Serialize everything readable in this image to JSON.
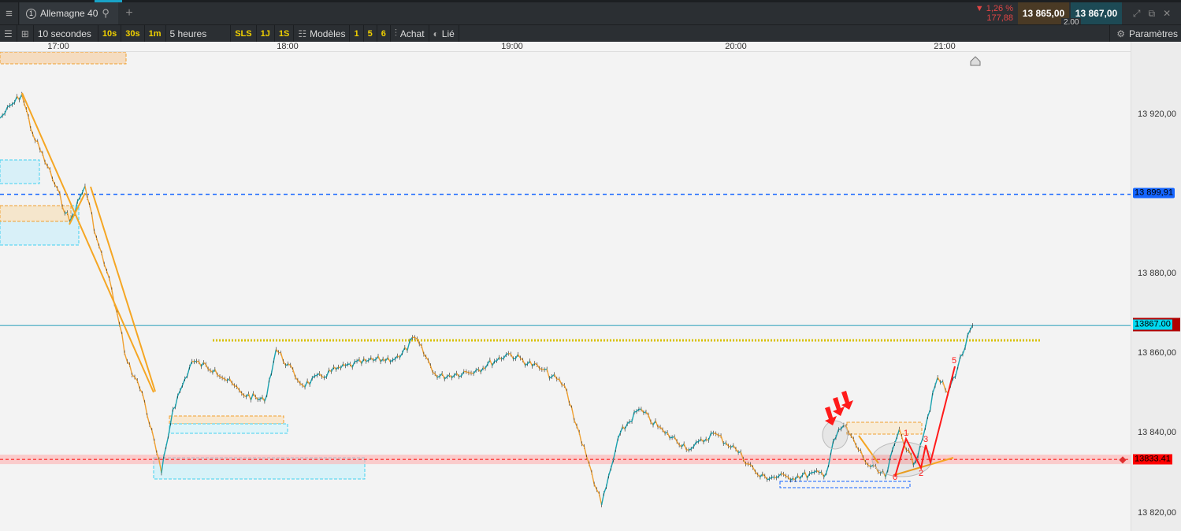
{
  "header": {
    "menu_icon": "hamburger-icon",
    "tab_number": "1",
    "tab_title": "Allemagne 40",
    "search_icon": "search-icon",
    "add_tab": "+",
    "change_pct": "▼ 1,26 %",
    "change_abs": "177,88",
    "bid": "13 865,00",
    "ask": "13 867,00",
    "spread": "2,00"
  },
  "toolbar": {
    "interval": "10 secondes",
    "quick_intervals": [
      "10s",
      "30s",
      "1m"
    ],
    "range": "5 heures",
    "quick_ranges": [
      "SLS",
      "1J",
      "1S"
    ],
    "templates": "Modèles",
    "template_slots": [
      "1",
      "5",
      "6"
    ],
    "buy": "Achat",
    "linked": "Lié",
    "settings": "Paramètres"
  },
  "chart_data": {
    "type": "line",
    "instrument": "Allemagne 40",
    "x_ticks": [
      "17:00",
      "18:00",
      "19:00",
      "20:00",
      "21:00"
    ],
    "y_ticks": [
      "13 920,00",
      "13 880,00",
      "13 860,00",
      "13 840,00",
      "13 820,00"
    ],
    "y_tick_values": [
      13920,
      13880,
      13860,
      13840,
      13820
    ],
    "ylim": [
      13816,
      13934
    ],
    "series": [
      {
        "points": [
          [
            "16:44",
            13919
          ],
          [
            "16:50",
            13925
          ],
          [
            "16:53",
            13915
          ],
          [
            "16:57",
            13907
          ],
          [
            "17:03",
            13893
          ],
          [
            "17:07",
            13902
          ],
          [
            "17:10",
            13889
          ],
          [
            "17:14",
            13876
          ],
          [
            "17:18",
            13858
          ],
          [
            "17:22",
            13850
          ],
          [
            "17:27",
            13830
          ],
          [
            "17:30",
            13846
          ],
          [
            "17:35",
            13858
          ],
          [
            "17:41",
            13856
          ],
          [
            "17:48",
            13850
          ],
          [
            "17:54",
            13848
          ],
          [
            "17:57",
            13861
          ],
          [
            "18:04",
            13852
          ],
          [
            "18:13",
            13856
          ],
          [
            "18:21",
            13858
          ],
          [
            "18:30",
            13859
          ],
          [
            "18:34",
            13864
          ],
          [
            "18:40",
            13854
          ],
          [
            "18:51",
            13856
          ],
          [
            "18:59",
            13860
          ],
          [
            "19:08",
            13856
          ],
          [
            "19:14",
            13852
          ],
          [
            "19:20",
            13834
          ],
          [
            "19:24",
            13822
          ],
          [
            "19:29",
            13840
          ],
          [
            "19:34",
            13846
          ],
          [
            "19:41",
            13840
          ],
          [
            "19:48",
            13836
          ],
          [
            "19:54",
            13840
          ],
          [
            "20:00",
            13836
          ],
          [
            "20:07",
            13829
          ],
          [
            "20:15",
            13829
          ],
          [
            "20:26",
            13830
          ],
          [
            "20:28",
            13838
          ],
          [
            "20:31",
            13842
          ],
          [
            "20:38",
            13832
          ],
          [
            "20:43",
            13829
          ],
          [
            "20:47",
            13841
          ],
          [
            "20:51",
            13832
          ],
          [
            "20:53",
            13837
          ],
          [
            "20:58",
            13854
          ],
          [
            "21:01",
            13850
          ],
          [
            "21:08",
            13867
          ]
        ]
      }
    ],
    "levels": [
      {
        "label": "13 899,91",
        "value": 13899.91,
        "color": "#1565ff"
      },
      {
        "label": "13867.00",
        "value": 13867.0,
        "color": "#00d8f0"
      },
      {
        "label": "13833.41",
        "value": 13833.41,
        "color": "#ff0000"
      }
    ],
    "wave_labels": [
      "0",
      "1",
      "2",
      "3",
      "5"
    ],
    "colors": {
      "up": "#1aa3b0",
      "down": "#f0a030",
      "wave": "#ff1a1a",
      "trend": "#f5a623"
    }
  }
}
